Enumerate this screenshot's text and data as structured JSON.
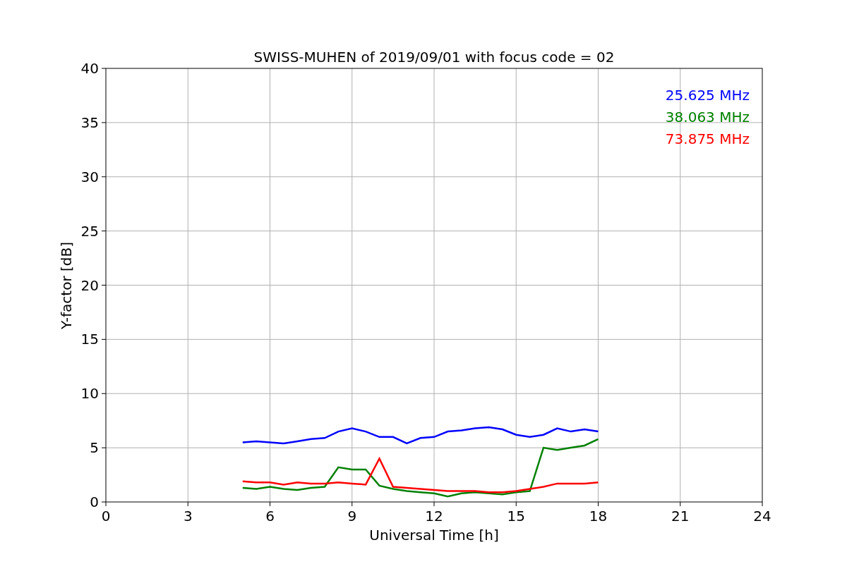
{
  "chart_data": {
    "type": "line",
    "title": "SWISS-MUHEN of 2019/09/01 with focus code = 02",
    "xlabel": "Universal Time [h]",
    "ylabel": "Y-factor [dB]",
    "x": [
      5,
      5.5,
      6,
      6.5,
      7,
      7.5,
      8,
      8.5,
      9,
      9.5,
      10,
      10.5,
      11,
      11.5,
      12,
      12.5,
      13,
      13.5,
      14,
      14.5,
      15,
      15.5,
      16,
      16.5,
      17,
      17.5,
      18
    ],
    "series": [
      {
        "name": "25.625 MHz",
        "color": "#0000ff",
        "values": [
          5.5,
          5.6,
          5.5,
          5.4,
          5.6,
          5.8,
          5.9,
          6.5,
          6.8,
          6.5,
          6.0,
          6.0,
          5.4,
          5.9,
          6.0,
          6.5,
          6.6,
          6.8,
          6.9,
          6.7,
          6.2,
          6.0,
          6.2,
          6.8,
          6.5,
          6.7,
          6.5
        ]
      },
      {
        "name": "38.063 MHz",
        "color": "#008000",
        "values": [
          1.3,
          1.2,
          1.4,
          1.2,
          1.1,
          1.3,
          1.4,
          3.2,
          3.0,
          3.0,
          1.5,
          1.2,
          1.0,
          0.9,
          0.8,
          0.5,
          0.8,
          0.9,
          0.8,
          0.7,
          0.9,
          1.0,
          5.0,
          4.8,
          5.0,
          5.2,
          5.8
        ]
      },
      {
        "name": "73.875 MHz",
        "color": "#ff0000",
        "values": [
          1.9,
          1.8,
          1.8,
          1.6,
          1.8,
          1.7,
          1.7,
          1.8,
          1.7,
          1.6,
          4.0,
          1.4,
          1.3,
          1.2,
          1.1,
          1.0,
          1.0,
          1.0,
          0.9,
          0.9,
          1.0,
          1.2,
          1.4,
          1.7,
          1.7,
          1.7,
          1.8
        ]
      }
    ],
    "xlim": [
      0,
      24
    ],
    "ylim": [
      0,
      40
    ],
    "xticks": [
      0,
      3,
      6,
      9,
      12,
      15,
      18,
      21,
      24
    ],
    "yticks": [
      0,
      5,
      10,
      15,
      20,
      25,
      30,
      35,
      40
    ],
    "grid": true
  }
}
